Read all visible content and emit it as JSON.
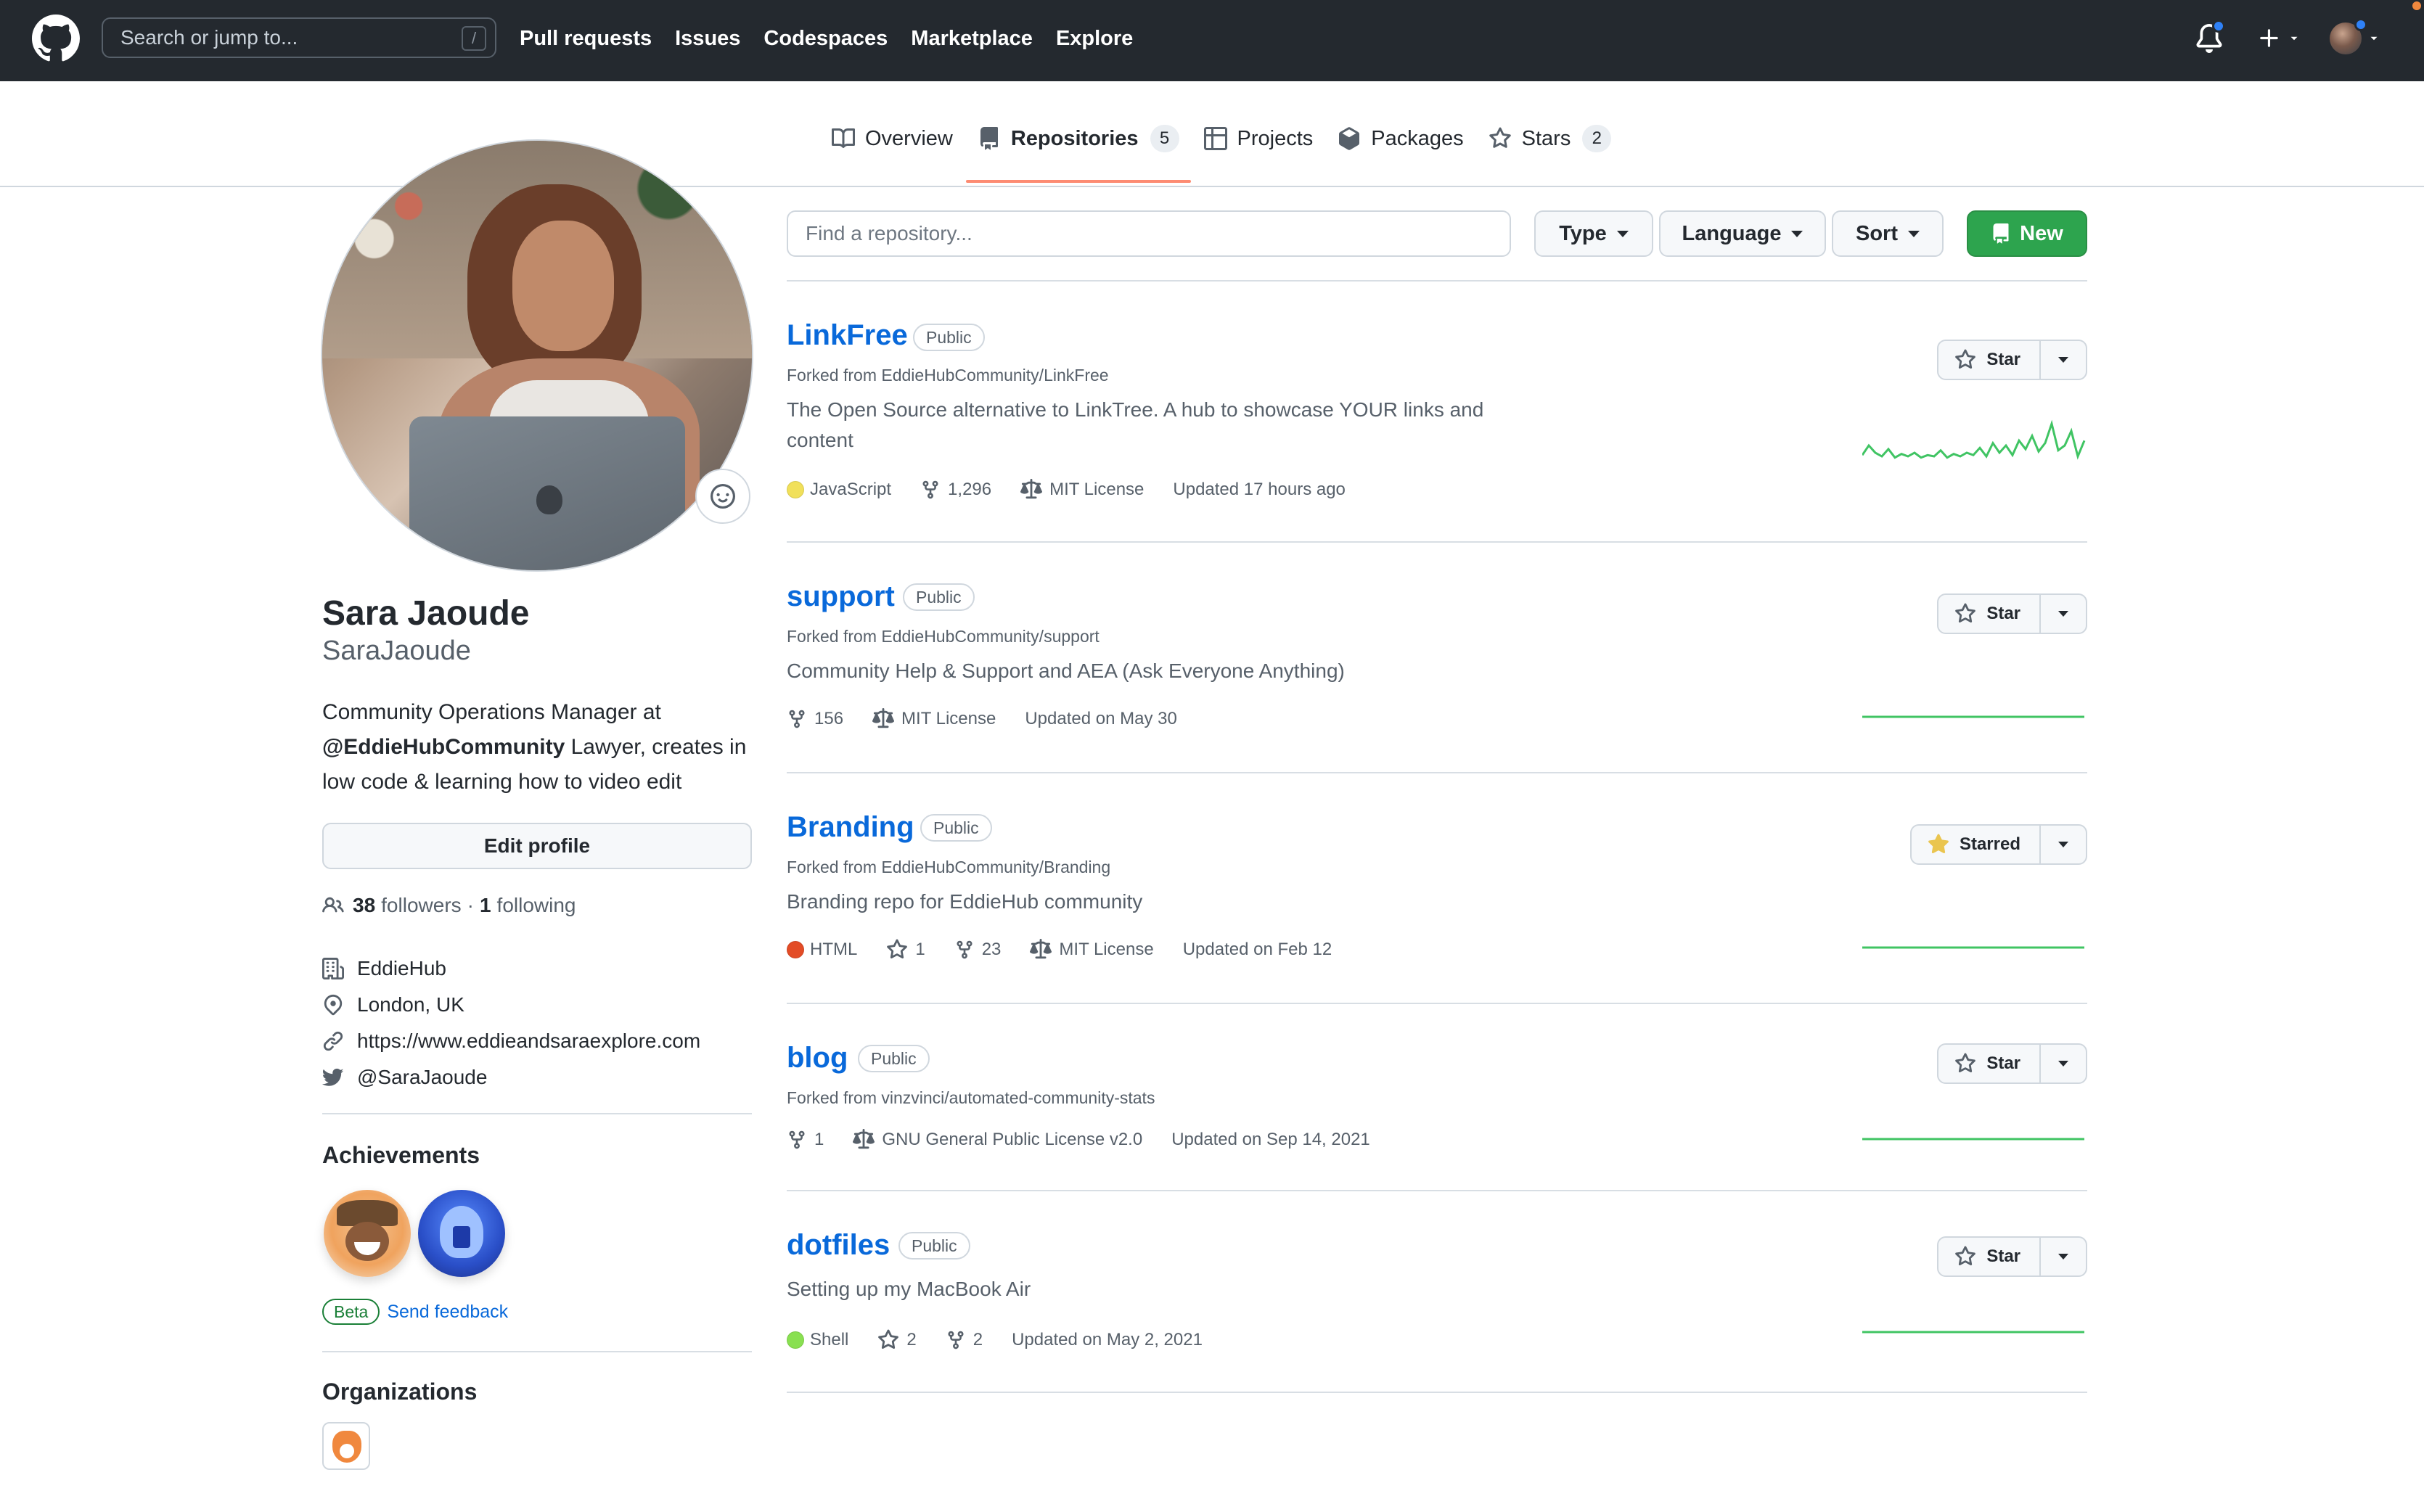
{
  "header": {
    "search_placeholder": "Search or jump to...",
    "search_shortcut": "/",
    "nav": [
      "Pull requests",
      "Issues",
      "Codespaces",
      "Marketplace",
      "Explore"
    ]
  },
  "tabs": [
    {
      "label": "Overview",
      "icon": "book-icon"
    },
    {
      "label": "Repositories",
      "count": "5",
      "icon": "repo-icon"
    },
    {
      "label": "Projects",
      "icon": "table-icon"
    },
    {
      "label": "Packages",
      "icon": "package-icon"
    },
    {
      "label": "Stars",
      "count": "2",
      "icon": "star-icon"
    }
  ],
  "profile": {
    "name": "Sara Jaoude",
    "login": "SaraJaoude",
    "bio_before": "Community Operations Manager at ",
    "bio_mention": "@EddieHubCommunity",
    "bio_after": " Lawyer, creates in low code & learning how to video edit",
    "edit_label": "Edit profile",
    "followers": "38",
    "followers_label": "followers",
    "following": "1",
    "following_label": "following",
    "company": "EddieHub",
    "location": "London, UK",
    "website": "https://www.eddieandsaraexplore.com",
    "twitter": "@SaraJaoude",
    "achievements_title": "Achievements",
    "beta_label": "Beta",
    "feedback_label": "Send feedback",
    "organizations_title": "Organizations"
  },
  "filters": {
    "find_placeholder": "Find a repository...",
    "type_label": "Type",
    "language_label": "Language",
    "sort_label": "Sort",
    "new_label": "New"
  },
  "repos": [
    {
      "name": "LinkFree",
      "visibility": "Public",
      "forked": "Forked from EddieHubCommunity/LinkFree",
      "description": "The Open Source alternative to LinkTree. A hub to showcase YOUR links and content",
      "language": "JavaScript",
      "language_color": "#f1e05a",
      "forks": "1,296",
      "license": "MIT License",
      "updated": "Updated 17 hours ago",
      "star_label": "Star",
      "activity": [
        4,
        12,
        6,
        3,
        9,
        2,
        5,
        3,
        6,
        2,
        4,
        3,
        8,
        2,
        5,
        3,
        6,
        4,
        10,
        3,
        14,
        6,
        12,
        4,
        16,
        9,
        20,
        7,
        14,
        30,
        8,
        12,
        24,
        3,
        16
      ]
    },
    {
      "name": "support",
      "visibility": "Public",
      "forked": "Forked from EddieHubCommunity/support",
      "description": "Community Help & Support and AEA (Ask Everyone Anything)",
      "forks": "156",
      "license": "MIT License",
      "updated": "Updated on May 30",
      "star_label": "Star"
    },
    {
      "name": "Branding",
      "visibility": "Public",
      "forked": "Forked from EddieHubCommunity/Branding",
      "description": "Branding repo for EddieHub community",
      "language": "HTML",
      "language_color": "#e34c26",
      "stars": "1",
      "forks": "23",
      "license": "MIT License",
      "updated": "Updated on Feb 12",
      "star_label": "Starred"
    },
    {
      "name": "blog",
      "visibility": "Public",
      "forked": "Forked from vinzvinci/automated-community-stats",
      "forks": "1",
      "license": "GNU General Public License v2.0",
      "updated": "Updated on Sep 14, 2021",
      "star_label": "Star"
    },
    {
      "name": "dotfiles",
      "visibility": "Public",
      "description": "Setting up my MacBook Air",
      "language": "Shell",
      "language_color": "#89e051",
      "stars": "2",
      "forks": "2",
      "updated": "Updated on May 2, 2021",
      "star_label": "Star"
    }
  ],
  "colors": {
    "header_bg": "#24292f",
    "link": "#0969da",
    "green": "#2da44e",
    "tab_underline": "#fd8c73",
    "starred": "#eac54f"
  }
}
